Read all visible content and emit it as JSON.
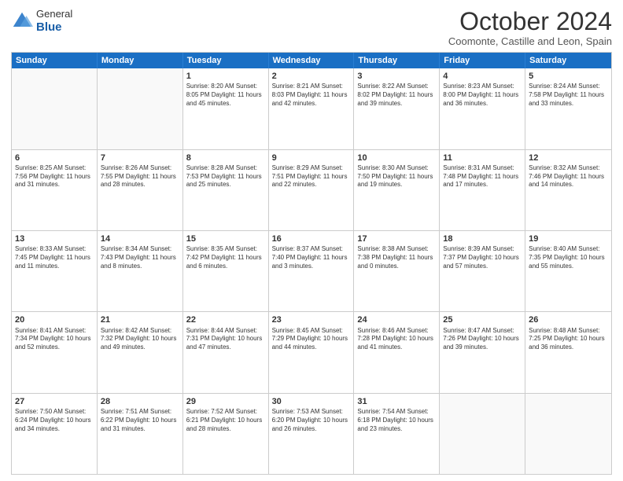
{
  "header": {
    "logo_general": "General",
    "logo_blue": "Blue",
    "title": "October 2024",
    "subtitle": "Coomonte, Castille and Leon, Spain"
  },
  "calendar": {
    "days": [
      "Sunday",
      "Monday",
      "Tuesday",
      "Wednesday",
      "Thursday",
      "Friday",
      "Saturday"
    ],
    "weeks": [
      [
        {
          "day": "",
          "info": ""
        },
        {
          "day": "",
          "info": ""
        },
        {
          "day": "1",
          "info": "Sunrise: 8:20 AM\nSunset: 8:05 PM\nDaylight: 11 hours and 45 minutes."
        },
        {
          "day": "2",
          "info": "Sunrise: 8:21 AM\nSunset: 8:03 PM\nDaylight: 11 hours and 42 minutes."
        },
        {
          "day": "3",
          "info": "Sunrise: 8:22 AM\nSunset: 8:02 PM\nDaylight: 11 hours and 39 minutes."
        },
        {
          "day": "4",
          "info": "Sunrise: 8:23 AM\nSunset: 8:00 PM\nDaylight: 11 hours and 36 minutes."
        },
        {
          "day": "5",
          "info": "Sunrise: 8:24 AM\nSunset: 7:58 PM\nDaylight: 11 hours and 33 minutes."
        }
      ],
      [
        {
          "day": "6",
          "info": "Sunrise: 8:25 AM\nSunset: 7:56 PM\nDaylight: 11 hours and 31 minutes."
        },
        {
          "day": "7",
          "info": "Sunrise: 8:26 AM\nSunset: 7:55 PM\nDaylight: 11 hours and 28 minutes."
        },
        {
          "day": "8",
          "info": "Sunrise: 8:28 AM\nSunset: 7:53 PM\nDaylight: 11 hours and 25 minutes."
        },
        {
          "day": "9",
          "info": "Sunrise: 8:29 AM\nSunset: 7:51 PM\nDaylight: 11 hours and 22 minutes."
        },
        {
          "day": "10",
          "info": "Sunrise: 8:30 AM\nSunset: 7:50 PM\nDaylight: 11 hours and 19 minutes."
        },
        {
          "day": "11",
          "info": "Sunrise: 8:31 AM\nSunset: 7:48 PM\nDaylight: 11 hours and 17 minutes."
        },
        {
          "day": "12",
          "info": "Sunrise: 8:32 AM\nSunset: 7:46 PM\nDaylight: 11 hours and 14 minutes."
        }
      ],
      [
        {
          "day": "13",
          "info": "Sunrise: 8:33 AM\nSunset: 7:45 PM\nDaylight: 11 hours and 11 minutes."
        },
        {
          "day": "14",
          "info": "Sunrise: 8:34 AM\nSunset: 7:43 PM\nDaylight: 11 hours and 8 minutes."
        },
        {
          "day": "15",
          "info": "Sunrise: 8:35 AM\nSunset: 7:42 PM\nDaylight: 11 hours and 6 minutes."
        },
        {
          "day": "16",
          "info": "Sunrise: 8:37 AM\nSunset: 7:40 PM\nDaylight: 11 hours and 3 minutes."
        },
        {
          "day": "17",
          "info": "Sunrise: 8:38 AM\nSunset: 7:38 PM\nDaylight: 11 hours and 0 minutes."
        },
        {
          "day": "18",
          "info": "Sunrise: 8:39 AM\nSunset: 7:37 PM\nDaylight: 10 hours and 57 minutes."
        },
        {
          "day": "19",
          "info": "Sunrise: 8:40 AM\nSunset: 7:35 PM\nDaylight: 10 hours and 55 minutes."
        }
      ],
      [
        {
          "day": "20",
          "info": "Sunrise: 8:41 AM\nSunset: 7:34 PM\nDaylight: 10 hours and 52 minutes."
        },
        {
          "day": "21",
          "info": "Sunrise: 8:42 AM\nSunset: 7:32 PM\nDaylight: 10 hours and 49 minutes."
        },
        {
          "day": "22",
          "info": "Sunrise: 8:44 AM\nSunset: 7:31 PM\nDaylight: 10 hours and 47 minutes."
        },
        {
          "day": "23",
          "info": "Sunrise: 8:45 AM\nSunset: 7:29 PM\nDaylight: 10 hours and 44 minutes."
        },
        {
          "day": "24",
          "info": "Sunrise: 8:46 AM\nSunset: 7:28 PM\nDaylight: 10 hours and 41 minutes."
        },
        {
          "day": "25",
          "info": "Sunrise: 8:47 AM\nSunset: 7:26 PM\nDaylight: 10 hours and 39 minutes."
        },
        {
          "day": "26",
          "info": "Sunrise: 8:48 AM\nSunset: 7:25 PM\nDaylight: 10 hours and 36 minutes."
        }
      ],
      [
        {
          "day": "27",
          "info": "Sunrise: 7:50 AM\nSunset: 6:24 PM\nDaylight: 10 hours and 34 minutes."
        },
        {
          "day": "28",
          "info": "Sunrise: 7:51 AM\nSunset: 6:22 PM\nDaylight: 10 hours and 31 minutes."
        },
        {
          "day": "29",
          "info": "Sunrise: 7:52 AM\nSunset: 6:21 PM\nDaylight: 10 hours and 28 minutes."
        },
        {
          "day": "30",
          "info": "Sunrise: 7:53 AM\nSunset: 6:20 PM\nDaylight: 10 hours and 26 minutes."
        },
        {
          "day": "31",
          "info": "Sunrise: 7:54 AM\nSunset: 6:18 PM\nDaylight: 10 hours and 23 minutes."
        },
        {
          "day": "",
          "info": ""
        },
        {
          "day": "",
          "info": ""
        }
      ]
    ]
  }
}
